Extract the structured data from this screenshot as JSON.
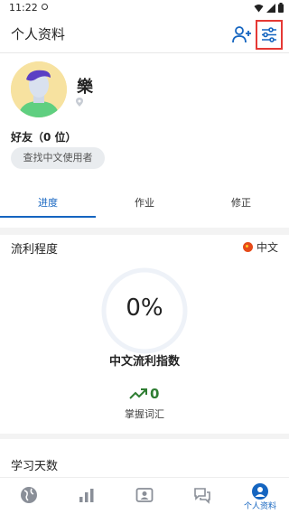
{
  "status_bar": {
    "time": "11:22"
  },
  "header": {
    "title": "个人资料"
  },
  "profile": {
    "username": "樂",
    "friends_label": "好友（0 位）",
    "find_button": "查找中文使用者"
  },
  "tabs": [
    {
      "label": "进度",
      "active": true
    },
    {
      "label": "作业",
      "active": false
    },
    {
      "label": "修正",
      "active": false
    }
  ],
  "fluency": {
    "title": "流利程度",
    "language": "中文",
    "percent": "0%",
    "index_label": "中文流利指数",
    "vocab_count": "0",
    "vocab_label": "掌握词汇"
  },
  "study_days": {
    "title": "学习天数"
  },
  "bottom_nav": {
    "active_label": "个人资料"
  },
  "colors": {
    "accent": "#1565c0",
    "highlight_box": "#e53935",
    "success": "#2e7d32"
  }
}
